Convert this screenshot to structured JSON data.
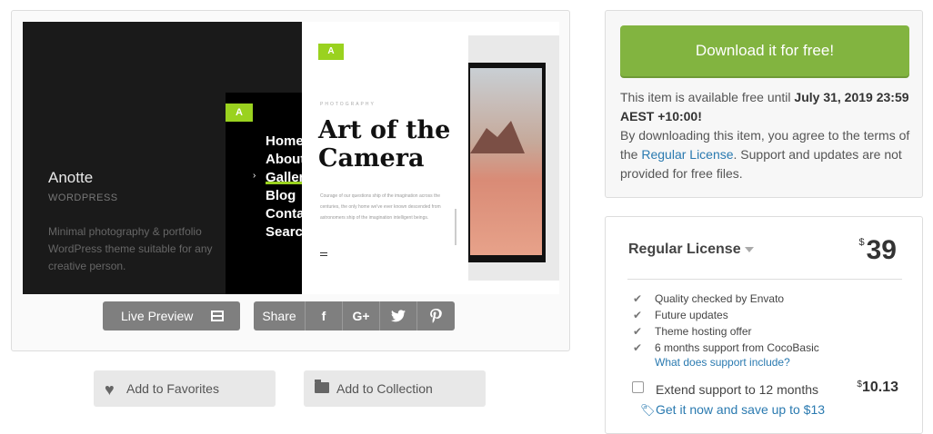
{
  "preview": {
    "theme_name": "Anotte",
    "theme_category": "WORDPRESS",
    "theme_description": "Minimal photography & portfolio WordPress theme suitable for any creative person.",
    "menu_logo": "A",
    "menu_items": [
      "Home",
      "About",
      "Gallery",
      "Blog",
      "Contact",
      "Search"
    ],
    "kicker": "PHOTOGRAPHY",
    "headline": "Art of the Camera",
    "body": "Courage of our questions ship of the imagination across the centuries, the only home we've ever known descended from astronomers ship of the imagination intelligent beings."
  },
  "actions": {
    "live_preview": "Live Preview",
    "share": "Share",
    "share_icons": [
      "f",
      "G+",
      "twitter",
      "pinterest"
    ],
    "add_favorites": "Add to Favorites",
    "add_collection": "Add to Collection"
  },
  "download": {
    "button": "Download it for free!",
    "text_before": "This item is available free until ",
    "date": "July 31, 2019 23:59 AEST +10:00!",
    "text_after": "By downloading this item, you agree to the terms of the ",
    "license_link": "Regular License",
    "text_end": ". Support and updates are not provided for free files."
  },
  "license": {
    "title": "Regular License",
    "currency": "$",
    "price": "39",
    "features": [
      "Quality checked by Envato",
      "Future updates",
      "Theme hosting offer",
      "6 months support from CocoBasic"
    ],
    "support_link": "What does support include?",
    "extend_label": "Extend support to 12 months",
    "extend_currency": "$",
    "extend_price": "10.13",
    "save_link": "Get it now and save up to $13"
  }
}
